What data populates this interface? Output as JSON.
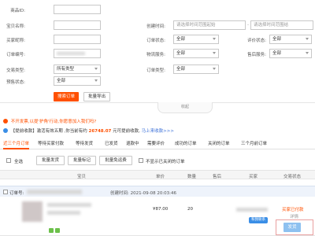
{
  "filters": {
    "product_id_label": "商品ID:",
    "item_name_label": "宝贝名称:",
    "buyer_nick_label": "买家昵称:",
    "order_no_label": "订单编号:",
    "trade_type_label": "交易类型:",
    "trade_type_value": "所有类型",
    "presale_label": "预售状态:",
    "presale_value": "全部",
    "created_time_label": "创建时间:",
    "start_placeholder": "请选择时间范围起始",
    "range_sep": "-",
    "end_placeholder": "请选择时间范围结",
    "order_status_label": "订单状态:",
    "order_status_value": "全部",
    "logistics_label": "物流服务:",
    "logistics_value": "全部",
    "order_type_label": "订单类型:",
    "order_type_value": "全部",
    "review_status_label": "评价状态:",
    "review_status_value": "全部",
    "after_sale_label": "售后服务:",
    "after_sale_value": "全部"
  },
  "actions": {
    "search": "搜索订单",
    "export": "批量导出"
  },
  "collapse_label": "收起",
  "notices": {
    "one": "不开发票,以提'护角'行动,你愿意加入我们吗?",
    "two_prefix": "【提前收款】激活有效五期 ,你当前有约",
    "amount": "26748.07",
    "two_suffix": "元可提前收款,",
    "link": "马上来收款>>>"
  },
  "tabs": [
    "近三个月订单",
    "等待买家付款",
    "等待发货",
    "已发货",
    "退款中",
    "需要评价",
    "成功的订单",
    "关闭的订单",
    "三个月前订单"
  ],
  "bulk": {
    "select_all": "全选",
    "btn1": "批量发货",
    "btn2": "批量标记",
    "btn3": "批量免运费",
    "hide_closed": "不显示已关闭的订单"
  },
  "table_headers": {
    "item": "宝贝",
    "price": "单价",
    "qty": "数量",
    "after_sale": "售后",
    "buyer": "买家",
    "trade_status": "交易状态"
  },
  "order": {
    "order_no_label": "订单号:",
    "created": "创建时间: 2021-09-08 20:03:46",
    "price": "¥87.00",
    "qty": "20",
    "status": "买家已付款",
    "detail": "详情",
    "buyer_badge": "和我联系",
    "ship_button": "发货",
    "accent": "#ff5000"
  }
}
